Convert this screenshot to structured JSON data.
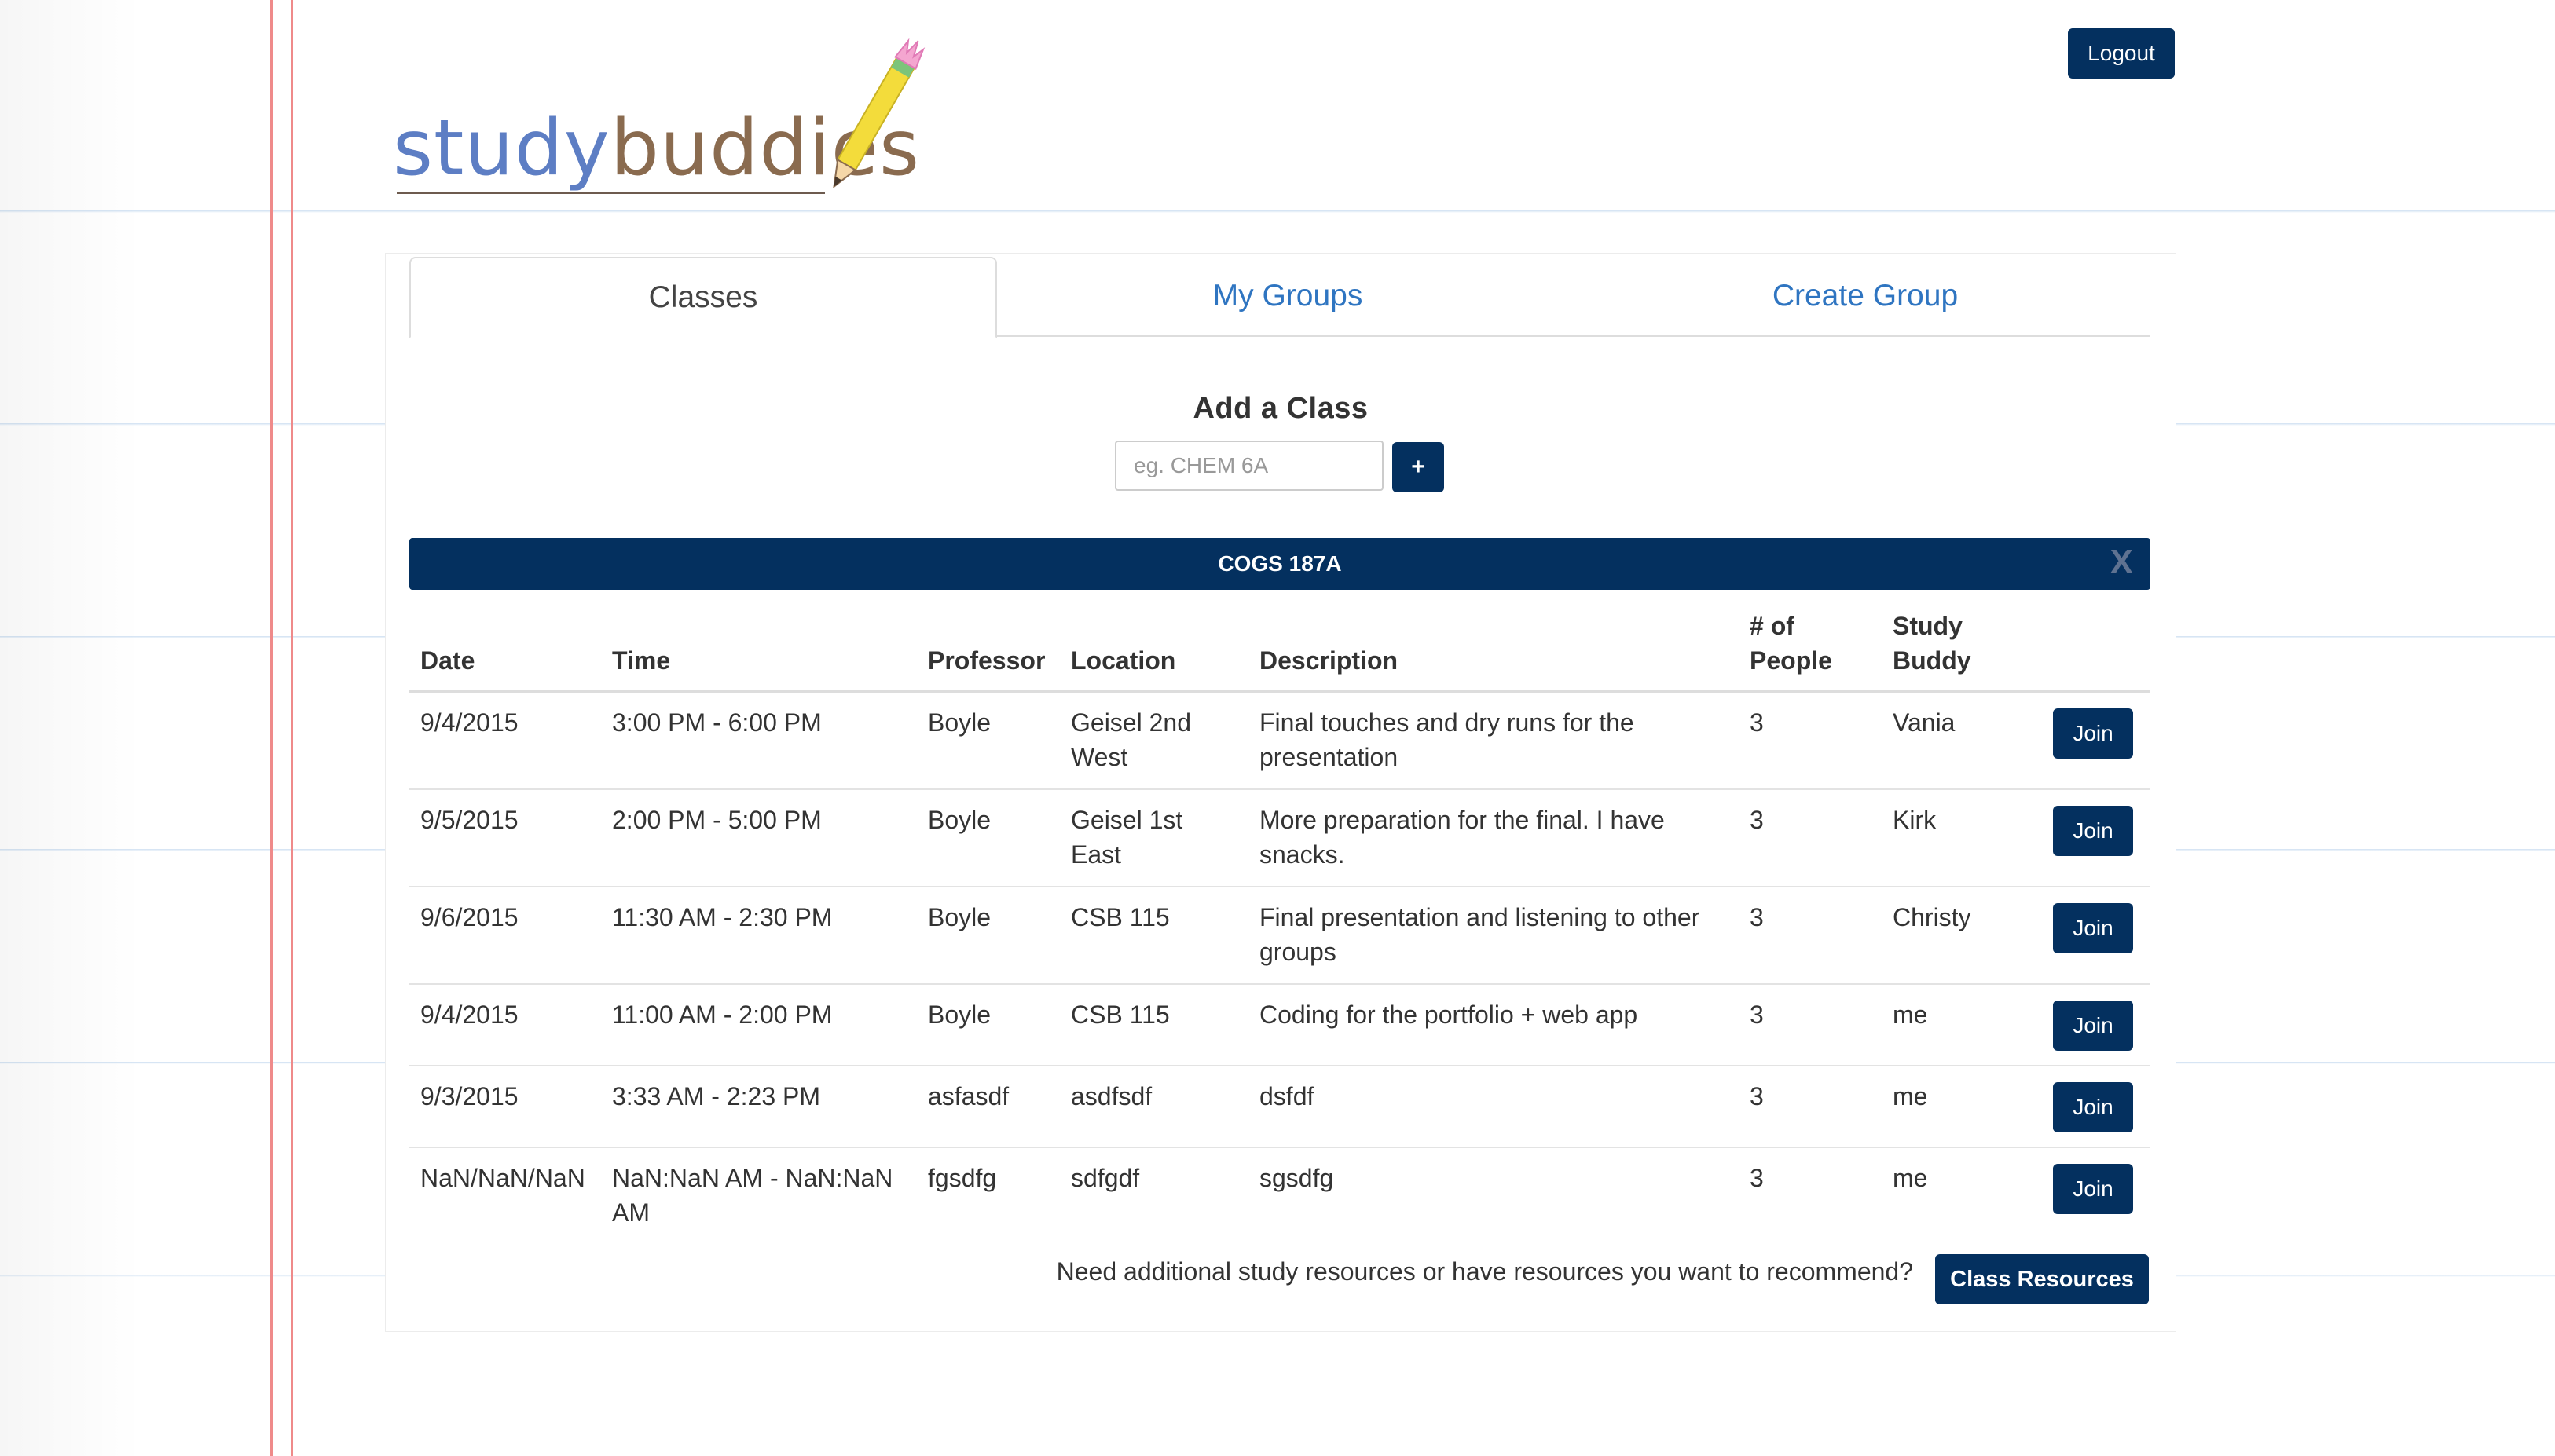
{
  "app": {
    "logo_part1": "study",
    "logo_part2": "buddies",
    "logout_label": "Logout"
  },
  "tabs": [
    {
      "label": "Classes",
      "active": true
    },
    {
      "label": "My Groups",
      "active": false
    },
    {
      "label": "Create Group",
      "active": false
    }
  ],
  "add_class": {
    "title": "Add a Class",
    "placeholder": "eg. CHEM 6A",
    "value": "",
    "add_label": "+"
  },
  "class_section": {
    "name": "COGS 187A",
    "close_label": "X"
  },
  "table": {
    "headers": {
      "date": "Date",
      "time": "Time",
      "professor": "Professor",
      "location": "Location",
      "description": "Description",
      "people_line1": "# of",
      "people_line2": "People",
      "buddy_line1": "Study",
      "buddy_line2": "Buddy"
    },
    "join_label": "Join",
    "rows": [
      {
        "date": "9/4/2015",
        "time": "3:00 PM - 6:00 PM",
        "professor": "Boyle",
        "location": "Geisel 2nd West",
        "description": "Final touches and dry runs for the presentation",
        "people": "3",
        "buddy": "Vania"
      },
      {
        "date": "9/5/2015",
        "time": "2:00 PM - 5:00 PM",
        "professor": "Boyle",
        "location": "Geisel 1st East",
        "description": "More preparation for the final. I have snacks.",
        "people": "3",
        "buddy": "Kirk"
      },
      {
        "date": "9/6/2015",
        "time": "11:30 AM - 2:30 PM",
        "professor": "Boyle",
        "location": "CSB 115",
        "description": "Final presentation and listening to other groups",
        "people": "3",
        "buddy": "Christy"
      },
      {
        "date": "9/4/2015",
        "time": "11:00 AM - 2:00 PM",
        "professor": "Boyle",
        "location": "CSB 115",
        "description": "Coding for the portfolio + web app",
        "people": "3",
        "buddy": "me"
      },
      {
        "date": "9/3/2015",
        "time": "3:33 AM - 2:23 PM",
        "professor": "asfasdf",
        "location": "asdfsdf",
        "description": "dsfdf",
        "people": "3",
        "buddy": "me"
      },
      {
        "date": "NaN/NaN/NaN",
        "time": "NaN:NaN AM - NaN:NaN AM",
        "professor": "fgsdfg",
        "location": "sdfgdf",
        "description": "sgsdfg",
        "people": "3",
        "buddy": "me"
      }
    ]
  },
  "footer": {
    "prompt": "Need additional study resources or have resources you want to recommend?",
    "resources_label": "Class Resources"
  },
  "colors": {
    "primary": "#04305f",
    "link": "#2f75c1",
    "margin_line": "#ef8a8a",
    "ruled_line": "#cfe0f2"
  }
}
